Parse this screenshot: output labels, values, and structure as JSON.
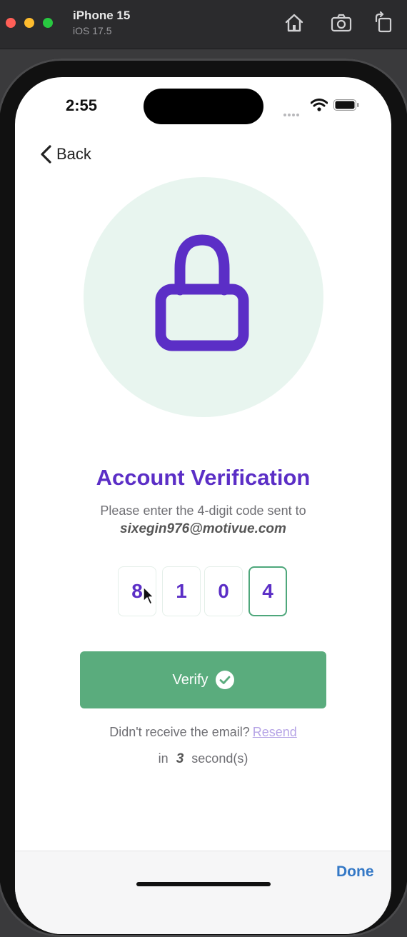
{
  "simulator": {
    "device_name": "iPhone 15",
    "os_version": "iOS 17.5"
  },
  "status_bar": {
    "time": "2:55"
  },
  "nav": {
    "back_label": "Back"
  },
  "verification": {
    "title": "Account Verification",
    "instruction": "Please enter the 4-digit code sent to",
    "email": "sixegin976@motivue.com",
    "code_digits": [
      "8",
      "1",
      "0",
      "4"
    ],
    "verify_label": "Verify",
    "resend_prompt": "Didn't receive the email?",
    "resend_link": "Resend",
    "countdown_prefix": "in",
    "countdown_value": "3",
    "countdown_suffix": "second(s)"
  },
  "keyboard_toolbar": {
    "done_label": "Done"
  },
  "colors": {
    "accent_purple": "#5b2ec6",
    "verify_green": "#5aac7d",
    "circle_bg": "#e8f5ef",
    "done_blue": "#3478c6"
  }
}
